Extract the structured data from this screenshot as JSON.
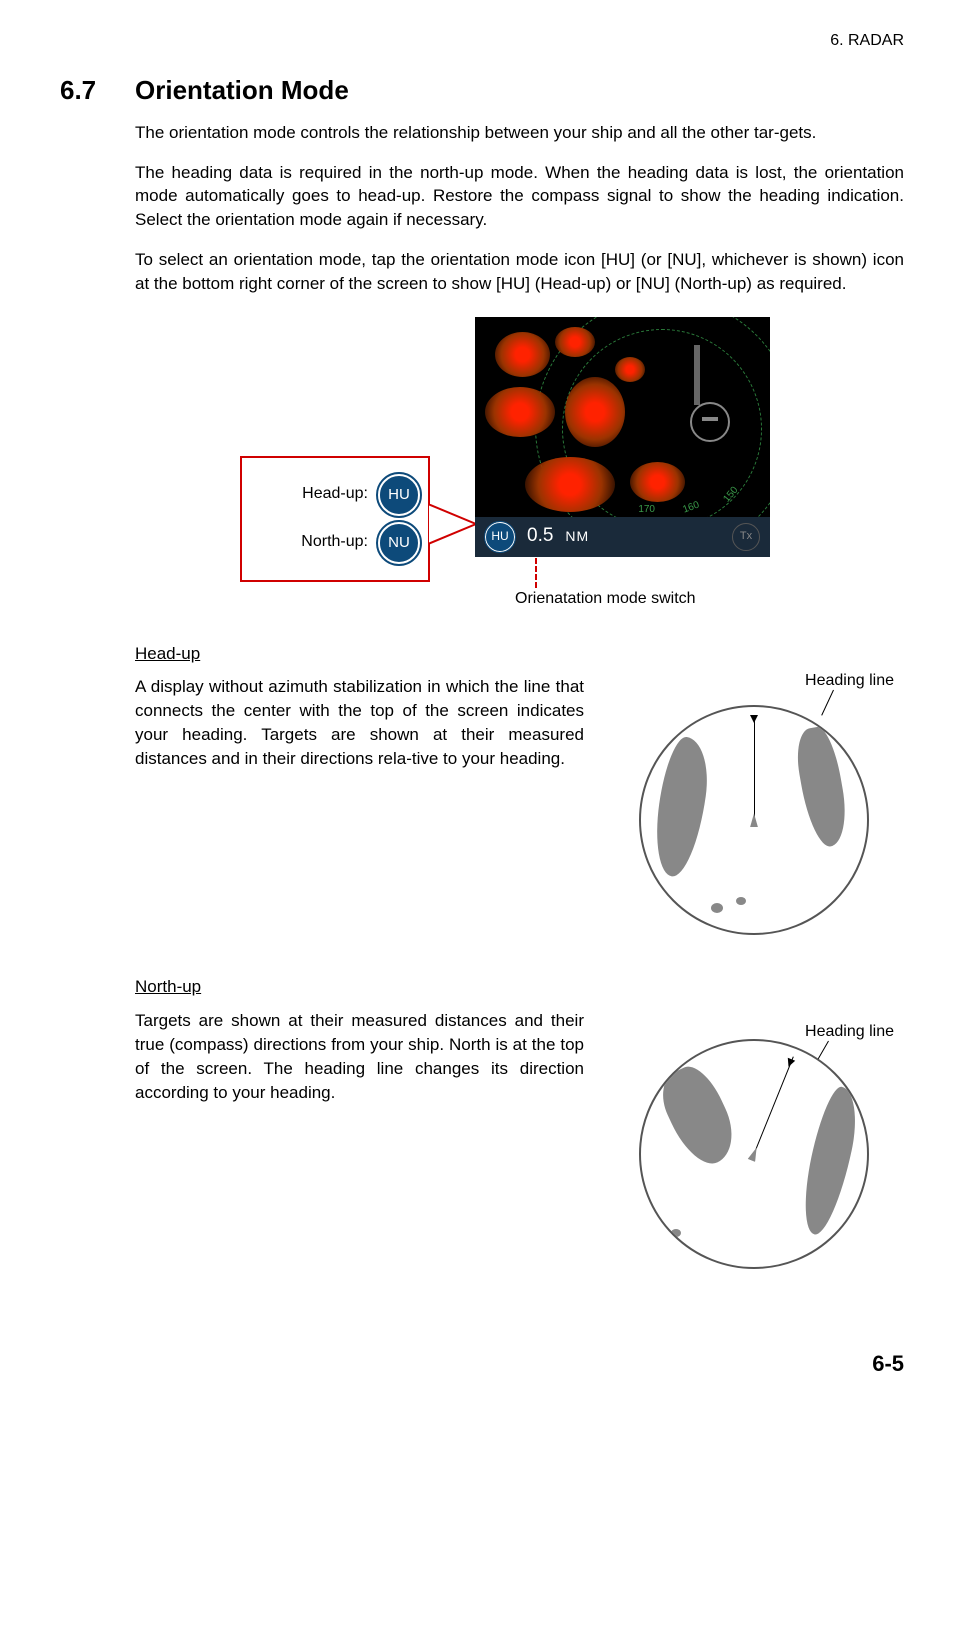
{
  "header": {
    "chapter": "6.  RADAR"
  },
  "section": {
    "number": "6.7",
    "title": "Orientation Mode"
  },
  "paragraphs": {
    "p1": "The orientation mode controls the relationship between your ship and all the other tar-gets.",
    "p2": "The heading data is required in the north-up mode. When the heading data is lost, the orientation mode automatically goes to head-up. Restore the compass signal to show the heading indication. Select the orientation mode again if necessary.",
    "p3": "To select an orientation mode, tap the orientation mode icon [HU] (or [NU], whichever is shown) icon at the bottom right corner of the screen to show [HU] (Head-up) or [NU] (North-up) as required."
  },
  "legend": {
    "headup_label": "Head-up:",
    "northup_label": "North-up:",
    "hu_badge": "HU",
    "nu_badge": "NU"
  },
  "radar_bar": {
    "mode": "HU",
    "range_value": "0.5",
    "range_unit": "NM",
    "tx_label": "Tx",
    "tick_150": "150",
    "tick_160": "160",
    "tick_170": "170"
  },
  "annotation": {
    "orientation_switch": "Orienatation mode switch"
  },
  "headup_section": {
    "title": "Head-up",
    "body": "A display without azimuth stabilization in which the line that connects the center with the top of the screen indicates your heading. Targets are shown at their measured distances and in their directions rela-tive to your heading.",
    "fig_label": "Heading line"
  },
  "northup_section": {
    "title": "North-up",
    "body": "Targets are shown at their measured distances and their true (compass) directions from your ship. North is at the top of the screen. The heading line changes its direction according to your heading.",
    "fig_label": "Heading line"
  },
  "footer": {
    "page": "6-5"
  }
}
